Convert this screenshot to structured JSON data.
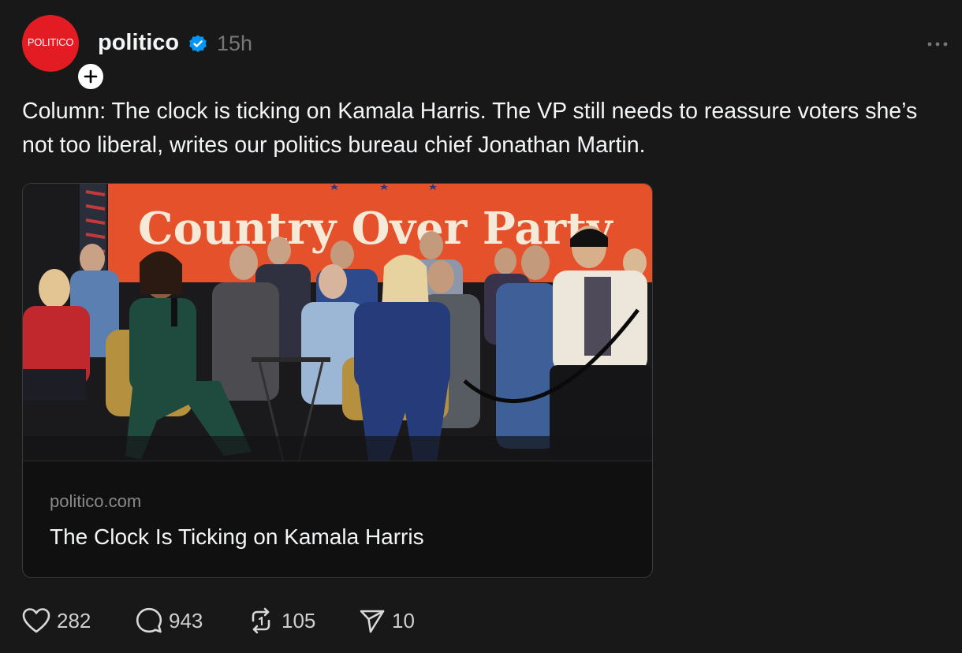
{
  "header": {
    "avatar_logo_text": "POLITICO",
    "username": "politico",
    "timestamp": "15h",
    "icons": {
      "follow": "plus-icon",
      "verified": "verified-badge-icon",
      "more": "more-options-icon"
    },
    "colors": {
      "avatar_bg": "#e31b23",
      "verified": "#0095f6"
    }
  },
  "post": {
    "caption": "Column: The clock is ticking on Kamala Harris. The VP still needs to reassure voters she’s not too liberal, writes our politics bureau chief Jonathan Martin."
  },
  "link_card": {
    "image_banner_text": "Country Over Party",
    "domain": "politico.com",
    "title": "The Clock Is Ticking on Kamala Harris"
  },
  "actions": {
    "like": {
      "icon": "heart-icon",
      "count": "282"
    },
    "reply": {
      "icon": "comment-bubble-icon",
      "count": "943"
    },
    "repost": {
      "icon": "repost-icon",
      "count": "105"
    },
    "share": {
      "icon": "send-icon",
      "count": "10"
    }
  },
  "theme": {
    "background": "#181818",
    "text": "#f3f5f7",
    "muted": "#777777"
  }
}
